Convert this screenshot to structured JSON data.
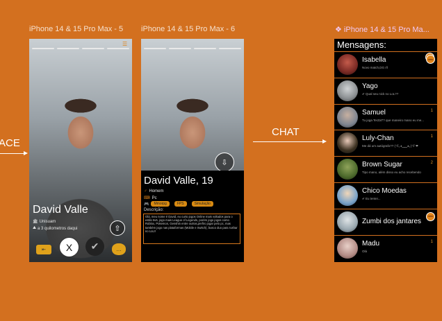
{
  "frames": {
    "frame5_label": "iPhone 14 & 15 Pro Max - 5",
    "frame6_label": "iPhone 14 & 15 Pro Max - 6",
    "frame_chat_label": "❖ iPhone 14 & 15 Pro Ma..."
  },
  "flows": {
    "left_label": "ACE",
    "chat_label": "CHAT"
  },
  "profile5": {
    "name": "David Valle",
    "university": "Unisuam",
    "distance": "a 3 quilometros daqui"
  },
  "profile6": {
    "name": "David Valle, 19",
    "gender": "Homem",
    "platform": "Pc",
    "tags": [
      "Mmorpg",
      "FPS",
      "Simulação"
    ],
    "desc_title": "Descrição:",
    "description": "Olá, meu nome é David, eu curto jogos Online mais voltados para o estilo 5v5, jogo mais League of Legends, porém jogo jogos como Roblox, Pokemon, Genshin entre outros,prefiro jogar pelo pc, mas também jogo nas plataformas (Mobile e Switch), busco duo para rushar no LoL!!"
  },
  "chat": {
    "title": "Mensagens:",
    "badge": "match",
    "items": [
      {
        "name": "Isabella",
        "preview": "Novo match,DG rll",
        "count": "",
        "badge": "new",
        "color": "#7a2a24"
      },
      {
        "name": "Yago",
        "preview": "✔ Qual  seu nick no  LoL??",
        "count": "",
        "badge": "",
        "color": "#8b8f92"
      },
      {
        "name": "Samuel",
        "preview": "Tu joga TerZaT? que maneiro mano eu me...",
        "count": "1",
        "badge": "",
        "color": "#7f8590"
      },
      {
        "name": "Luly-Chan",
        "preview": "Me dá um autógrafo?? (⁠づ⁠｡⁠◕⁠‿⁠‿⁠◕⁠｡⁠)⁠づ ❤",
        "count": "1",
        "badge": "",
        "color": "#3b3020"
      },
      {
        "name": "Brown Sugar",
        "preview": "Tipo mano, além disso eu acho recebendo",
        "count": "2",
        "badge": "",
        "color": "#4d6a2c"
      },
      {
        "name": "Chico Moedas",
        "preview": "✔ Eu tentei...",
        "count": "",
        "badge": "",
        "color": "#7aa3c9"
      },
      {
        "name": "Zumbi dos jantares",
        "preview": "",
        "count": "",
        "badge": "new",
        "color": "#9aa8b0"
      },
      {
        "name": "Madu",
        "preview": "Olá",
        "count": "1",
        "badge": "",
        "color": "#b38c86"
      }
    ]
  },
  "colors": {
    "background": "#d3701f",
    "accent": "#e0841b"
  }
}
